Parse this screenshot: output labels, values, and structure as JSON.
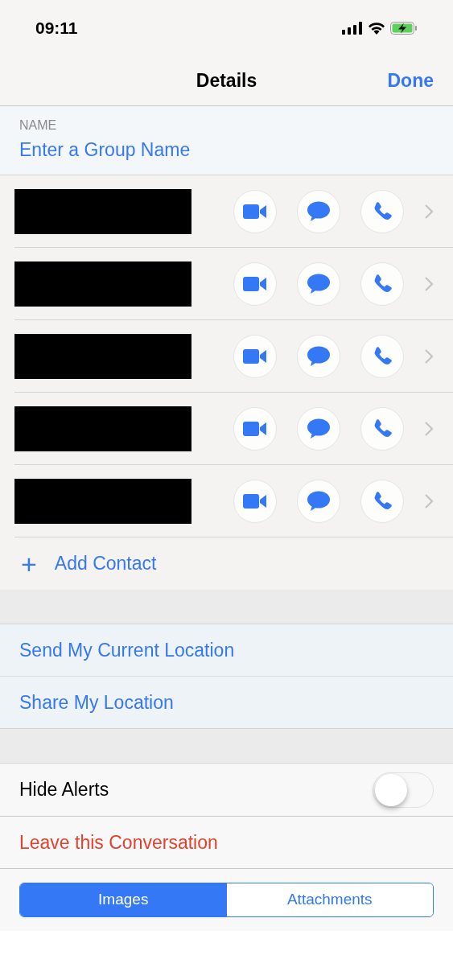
{
  "status_bar": {
    "time": "09:11"
  },
  "nav": {
    "title": "Details",
    "action": "Done"
  },
  "name_section": {
    "label": "NAME",
    "placeholder": "Enter a Group Name"
  },
  "contacts": [
    {
      "name_redacted": true
    },
    {
      "name_redacted": true
    },
    {
      "name_redacted": true
    },
    {
      "name_redacted": true
    },
    {
      "name_redacted": true
    }
  ],
  "add_contact": {
    "icon": "+",
    "label": "Add Contact"
  },
  "location": [
    "Send My Current Location",
    "Share My Location"
  ],
  "hide_alerts": {
    "label": "Hide Alerts",
    "on": false
  },
  "leave": "Leave this Conversation",
  "segments": [
    {
      "label": "Images",
      "selected": true
    },
    {
      "label": "Attachments",
      "selected": false
    }
  ]
}
